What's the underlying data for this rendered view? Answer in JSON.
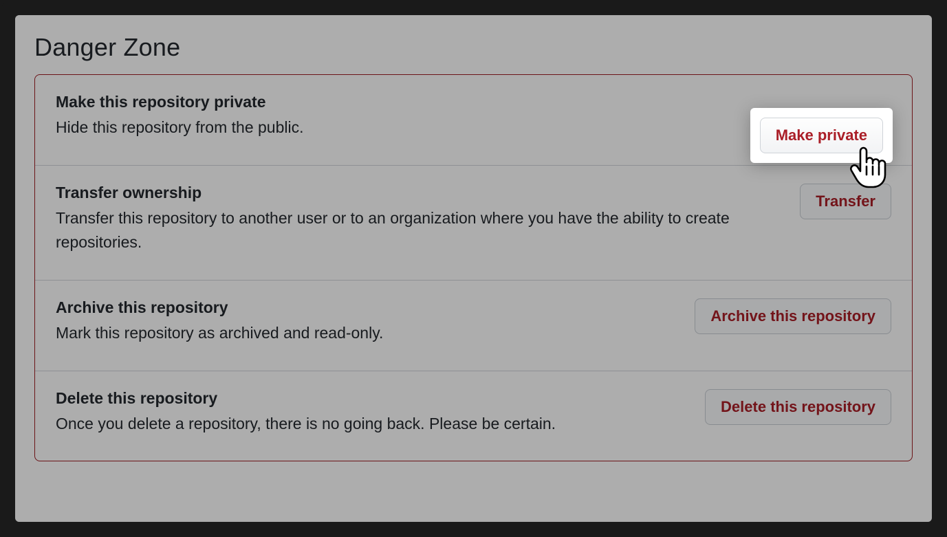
{
  "section": {
    "title": "Danger Zone"
  },
  "rows": [
    {
      "title": "Make this repository private",
      "description": "Hide this repository from the public.",
      "button_label": "Make private",
      "highlighted": true
    },
    {
      "title": "Transfer ownership",
      "description": "Transfer this repository to another user or to an organization where you have the ability to create repositories.",
      "button_label": "Transfer",
      "highlighted": false
    },
    {
      "title": "Archive this repository",
      "description": "Mark this repository as archived and read-only.",
      "button_label": "Archive this repository",
      "highlighted": false
    },
    {
      "title": "Delete this repository",
      "description": "Once you delete a repository, there is no going back. Please be certain.",
      "button_label": "Delete this repository",
      "highlighted": false
    }
  ]
}
